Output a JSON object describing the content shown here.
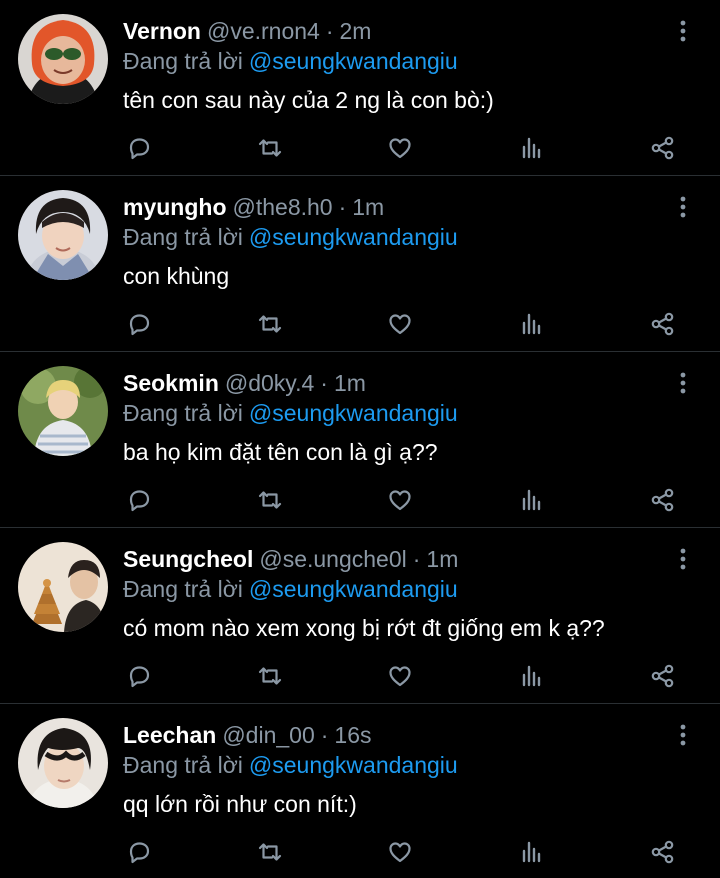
{
  "colors": {
    "background": "#000000",
    "text": "#ffffff",
    "muted": "#8b98a5",
    "link": "#1d9bf0",
    "divider": "#2a2f33"
  },
  "icons": {
    "reply": "reply-icon",
    "retweet": "retweet-icon",
    "like": "like-icon",
    "stats": "stats-icon",
    "share": "share-icon",
    "more": "more-vertical-icon"
  },
  "replies": [
    {
      "name": "Vernon",
      "handle": "@ve.rnon4",
      "separator": "·",
      "time": "2m",
      "reply_prefix": "Đang trả lời",
      "reply_to": "@seungkwandangiu",
      "text": "tên con sau này của 2 ng là con bò:)"
    },
    {
      "name": "myungho",
      "handle": "@the8.h0",
      "separator": "·",
      "time": "1m",
      "reply_prefix": "Đang trả lời",
      "reply_to": "@seungkwandangiu",
      "text": "con khùng"
    },
    {
      "name": "Seokmin",
      "handle": "@d0ky.4",
      "separator": "·",
      "time": "1m",
      "reply_prefix": "Đang trả lời",
      "reply_to": "@seungkwandangiu",
      "text": "ba họ kim đặt tên con là gì ạ??"
    },
    {
      "name": "Seungcheol",
      "handle": "@se.ungche0l",
      "separator": "·",
      "time": "1m",
      "reply_prefix": "Đang trả lời",
      "reply_to": "@seungkwandangiu",
      "text": "có mom nào xem xong bị rớt đt giống em k ạ??"
    },
    {
      "name": "Leechan",
      "handle": "@din_00",
      "separator": "·",
      "time": "16s",
      "reply_prefix": "Đang trả lời",
      "reply_to": "@seungkwandangiu",
      "text": "qq lớn rồi như con nít:)"
    }
  ]
}
